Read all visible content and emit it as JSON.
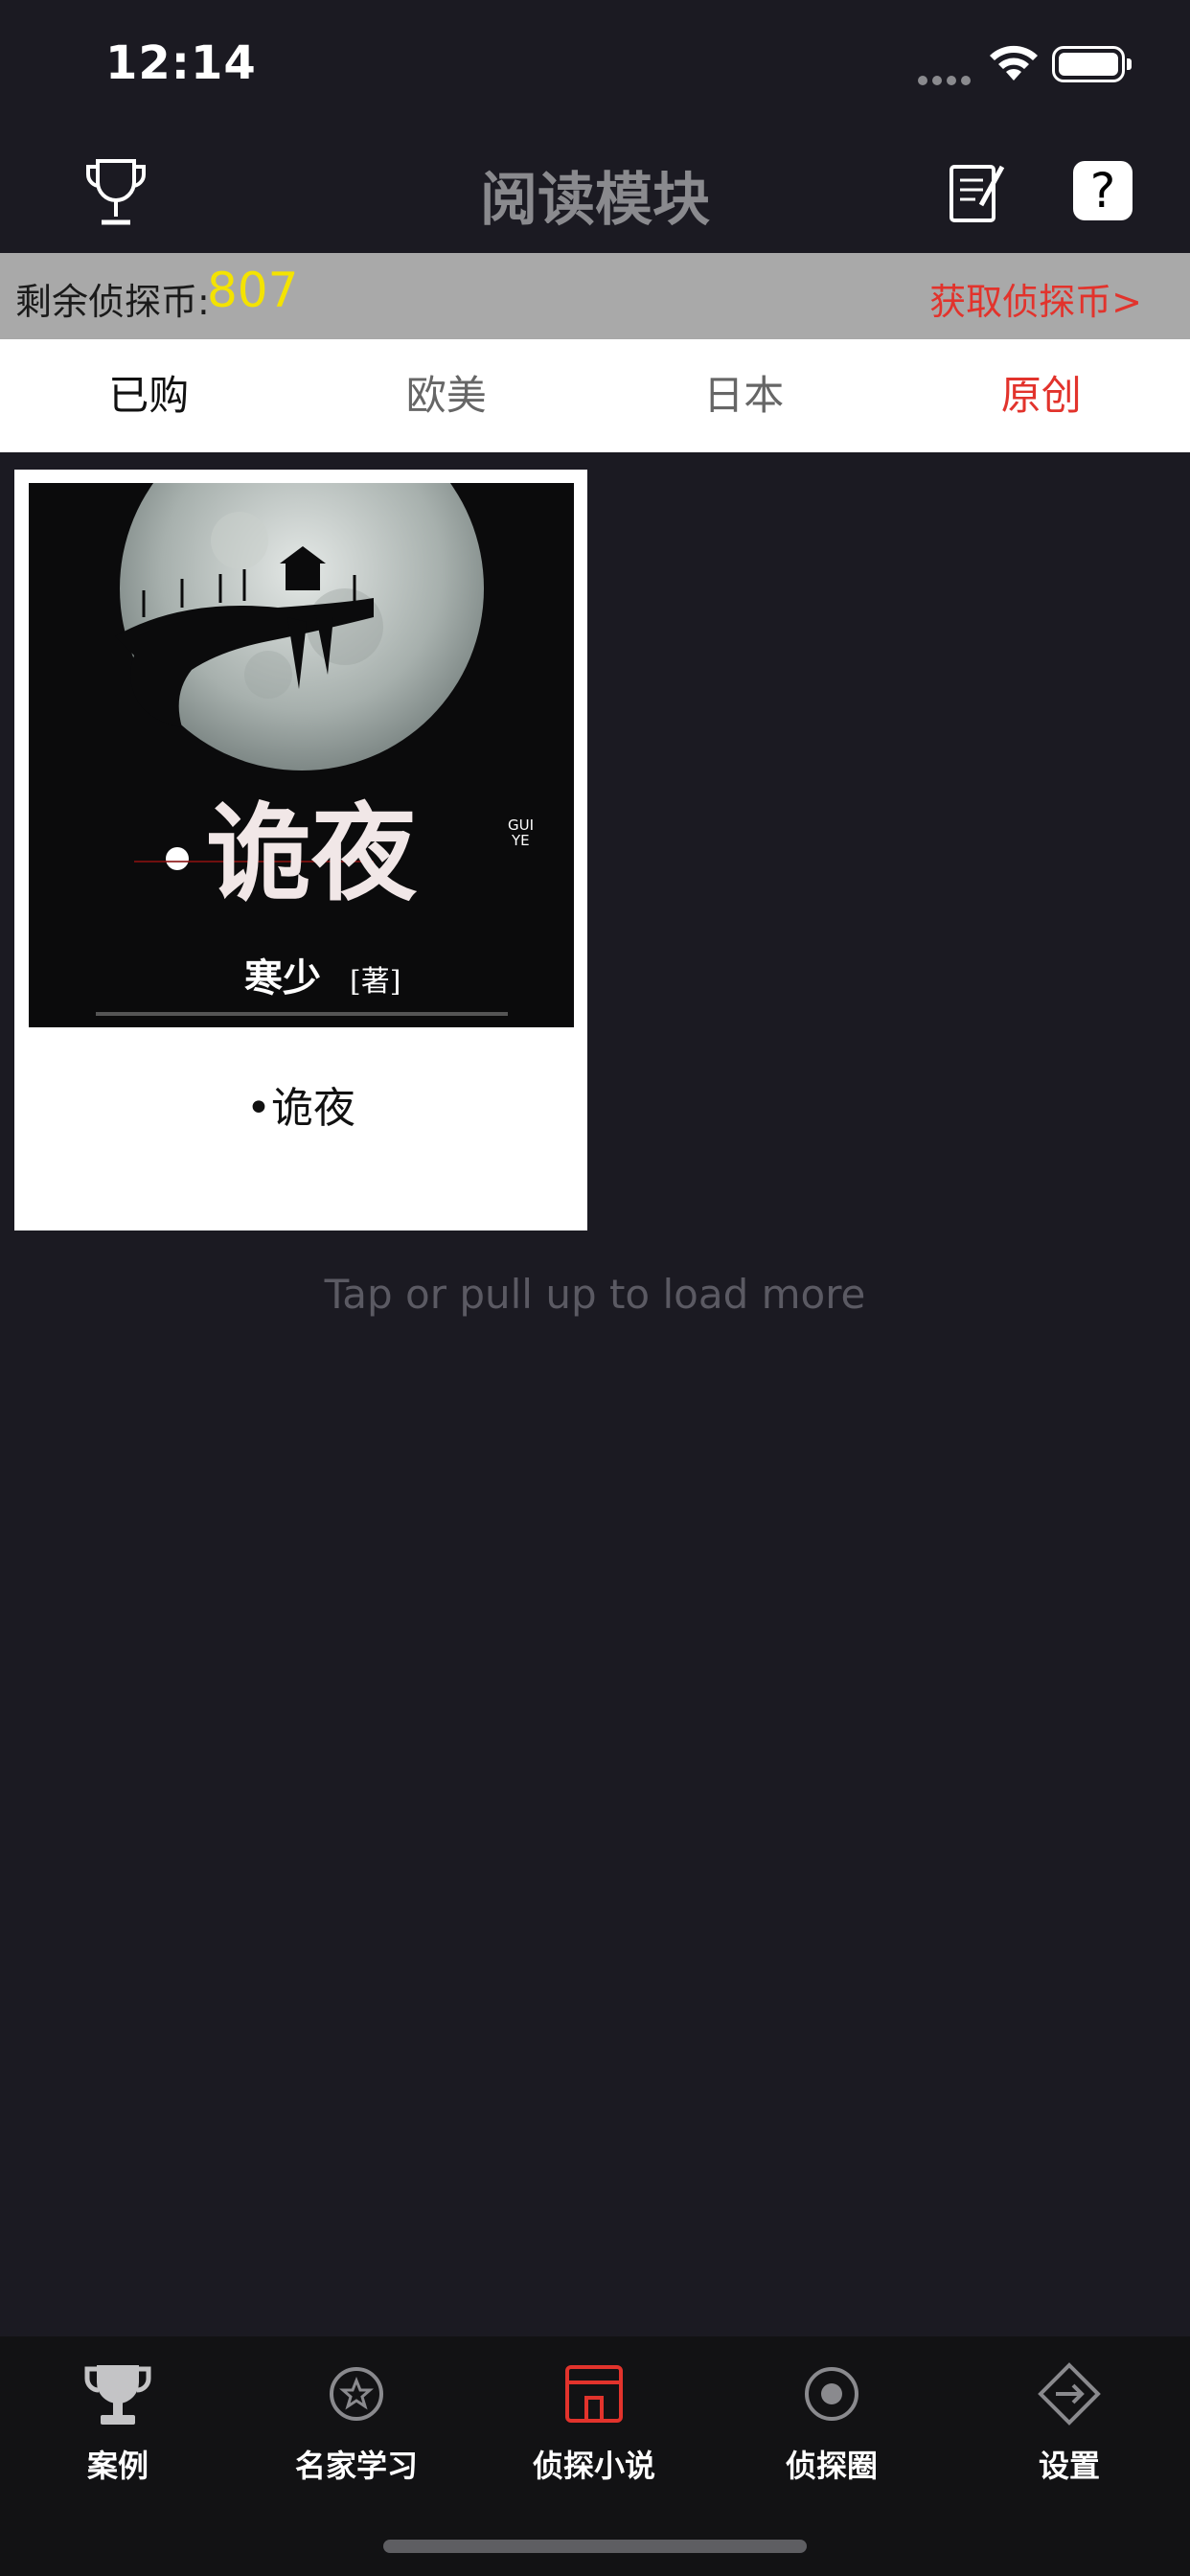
{
  "status": {
    "time": "12:14"
  },
  "nav": {
    "title": "阅读模块",
    "help_glyph": "?"
  },
  "coins": {
    "label": "剩余侦探币:",
    "value": "807",
    "link": "获取侦探币>"
  },
  "tabs": [
    {
      "label": "已购"
    },
    {
      "label": "欧美"
    },
    {
      "label": "日本"
    },
    {
      "label": "原创"
    }
  ],
  "book": {
    "title": "•诡夜",
    "cover_title": "诡夜",
    "cover_subtitle_1": "GUI",
    "cover_subtitle_2": "YE",
    "cover_author": "寒少",
    "cover_author_mark": "[著]"
  },
  "load_more": "Tap or pull up to load more",
  "tabbar": [
    {
      "label": "案例",
      "icon": "trophy-cup-icon"
    },
    {
      "label": "名家学习",
      "icon": "star-badge-icon"
    },
    {
      "label": "侦探小说",
      "icon": "book-icon"
    },
    {
      "label": "侦探圈",
      "icon": "circle-dot-icon"
    },
    {
      "label": "设置",
      "icon": "diamond-arrow-icon"
    }
  ],
  "colors": {
    "accent": "#e2332c",
    "coin": "#f4e300",
    "background": "#1b1a22"
  }
}
